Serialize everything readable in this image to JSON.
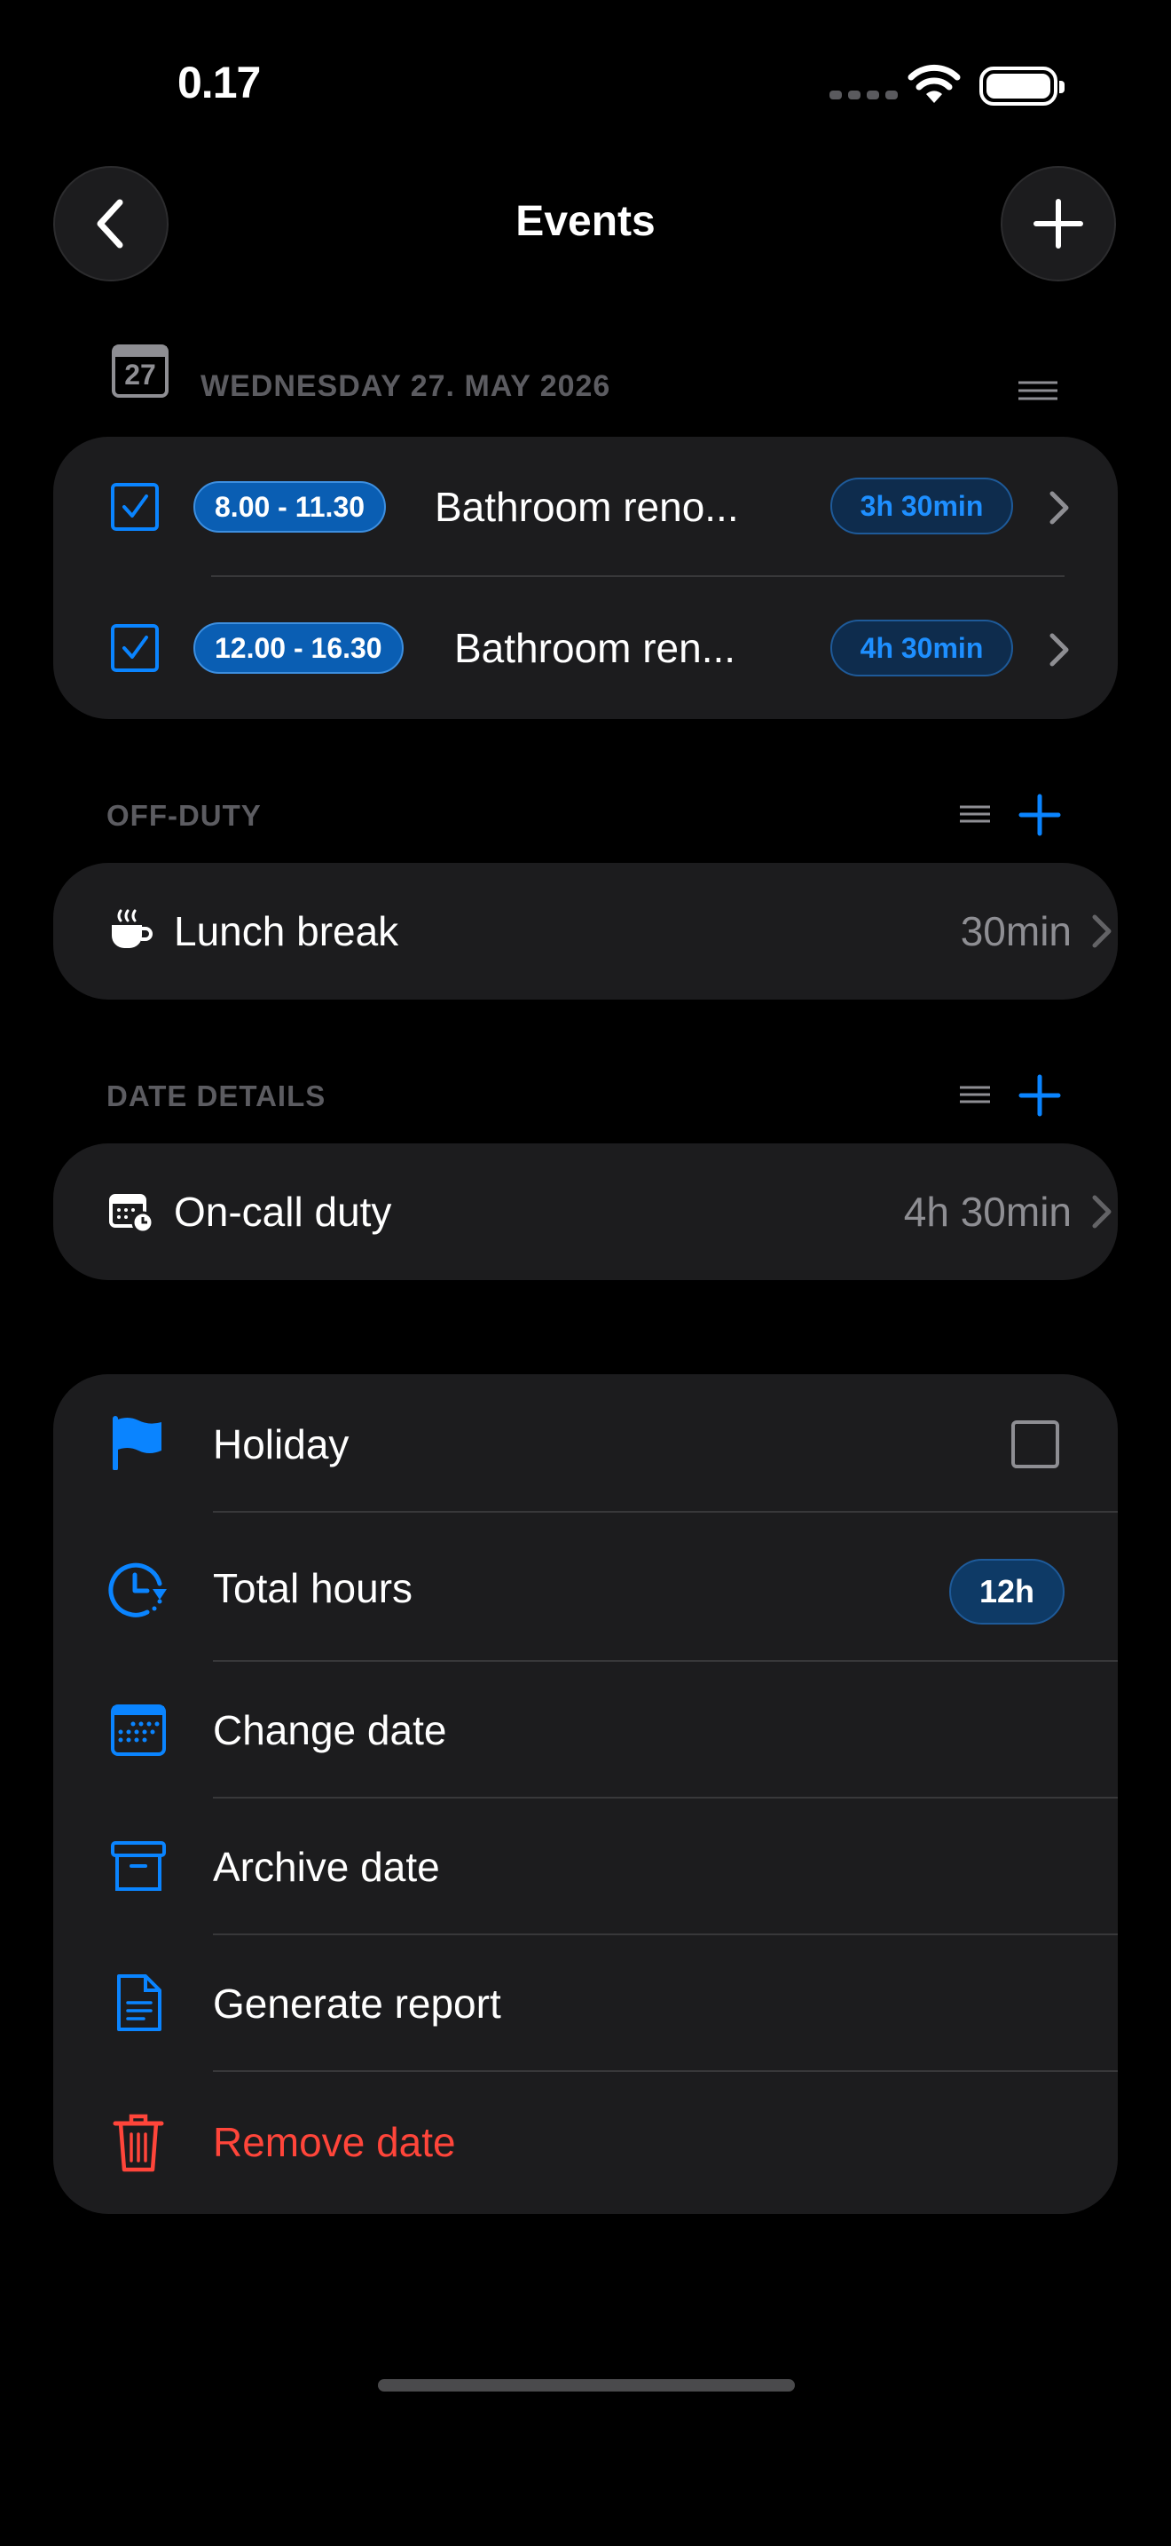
{
  "status_bar": {
    "time": "0.17"
  },
  "nav": {
    "title": "Events"
  },
  "date_section": {
    "calendar_day": "27",
    "date_label": "WEDNESDAY 27. MAY 2026",
    "events": [
      {
        "time": "8.00 - 11.30",
        "title": "Bathroom reno...",
        "duration": "3h 30min",
        "checked": true
      },
      {
        "time": "12.00 - 16.30",
        "title": "Bathroom ren...",
        "duration": "4h 30min",
        "checked": true
      }
    ]
  },
  "off_duty": {
    "label": "OFF-DUTY",
    "item": {
      "icon": "coffee-cup-icon",
      "label": "Lunch break",
      "value": "30min"
    }
  },
  "date_details": {
    "label": "DATE DETAILS",
    "item": {
      "icon": "calendar-clock-icon",
      "label": "On-call duty",
      "value": "4h 30min"
    }
  },
  "actions": {
    "holiday": {
      "label": "Holiday",
      "icon": "flag-icon"
    },
    "total_hours": {
      "label": "Total hours",
      "value": "12h",
      "icon": "clock-icon"
    },
    "change_date": {
      "label": "Change date",
      "icon": "calendar-icon"
    },
    "archive_date": {
      "label": "Archive date",
      "icon": "archive-icon"
    },
    "generate_report": {
      "label": "Generate report",
      "icon": "document-icon"
    },
    "remove_date": {
      "label": "Remove date",
      "icon": "trash-icon"
    }
  },
  "colors": {
    "accent": "#0a84ff",
    "danger": "#ff453a",
    "card": "#1c1c1e",
    "background": "#000000"
  }
}
